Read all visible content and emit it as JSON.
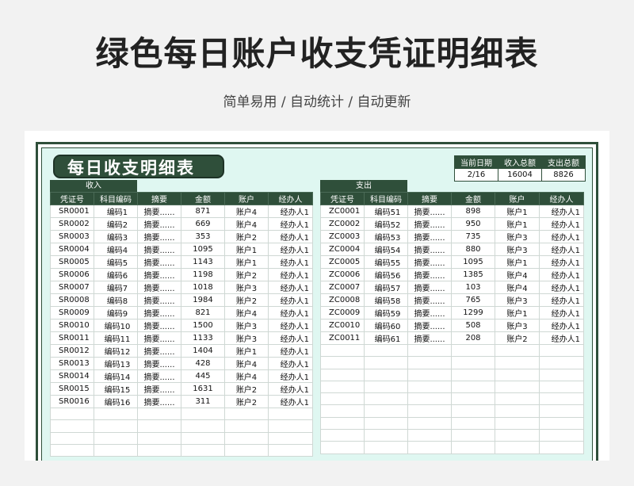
{
  "title": "绿色每日账户收支凭证明细表",
  "subtitle": "简单易用 / 自动统计 / 自动更新",
  "sheet_title": "每日收支明细表",
  "summary": {
    "headers": [
      "当前日期",
      "收入总额",
      "支出总额"
    ],
    "values": [
      "2/16",
      "16004",
      "8826"
    ]
  },
  "income": {
    "label": "收入",
    "headers": [
      "凭证号",
      "科目编码",
      "摘要",
      "金额",
      "账户",
      "经办人"
    ],
    "rows": [
      [
        "SR0001",
        "编码1",
        "摘要......",
        "871",
        "账户4",
        "经办人1"
      ],
      [
        "SR0002",
        "编码2",
        "摘要......",
        "669",
        "账户4",
        "经办人1"
      ],
      [
        "SR0003",
        "编码3",
        "摘要......",
        "353",
        "账户2",
        "经办人1"
      ],
      [
        "SR0004",
        "编码4",
        "摘要......",
        "1095",
        "账户1",
        "经办人1"
      ],
      [
        "SR0005",
        "编码5",
        "摘要......",
        "1143",
        "账户1",
        "经办人1"
      ],
      [
        "SR0006",
        "编码6",
        "摘要......",
        "1198",
        "账户2",
        "经办人1"
      ],
      [
        "SR0007",
        "编码7",
        "摘要......",
        "1018",
        "账户3",
        "经办人1"
      ],
      [
        "SR0008",
        "编码8",
        "摘要......",
        "1984",
        "账户2",
        "经办人1"
      ],
      [
        "SR0009",
        "编码9",
        "摘要......",
        "821",
        "账户4",
        "经办人1"
      ],
      [
        "SR0010",
        "编码10",
        "摘要......",
        "1500",
        "账户3",
        "经办人1"
      ],
      [
        "SR0011",
        "编码11",
        "摘要......",
        "1133",
        "账户3",
        "经办人1"
      ],
      [
        "SR0012",
        "编码12",
        "摘要......",
        "1404",
        "账户1",
        "经办人1"
      ],
      [
        "SR0013",
        "编码13",
        "摘要......",
        "428",
        "账户4",
        "经办人1"
      ],
      [
        "SR0014",
        "编码14",
        "摘要......",
        "445",
        "账户4",
        "经办人1"
      ],
      [
        "SR0015",
        "编码15",
        "摘要......",
        "1631",
        "账户2",
        "经办人1"
      ],
      [
        "SR0016",
        "编码16",
        "摘要......",
        "311",
        "账户2",
        "经办人1"
      ]
    ]
  },
  "expense": {
    "label": "支出",
    "headers": [
      "凭证号",
      "科目编码",
      "摘要",
      "金额",
      "账户",
      "经办人"
    ],
    "rows": [
      [
        "ZC0001",
        "编码51",
        "摘要......",
        "898",
        "账户1",
        "经办人1"
      ],
      [
        "ZC0002",
        "编码52",
        "摘要......",
        "950",
        "账户1",
        "经办人1"
      ],
      [
        "ZC0003",
        "编码53",
        "摘要......",
        "735",
        "账户3",
        "经办人1"
      ],
      [
        "ZC0004",
        "编码54",
        "摘要......",
        "880",
        "账户3",
        "经办人1"
      ],
      [
        "ZC0005",
        "编码55",
        "摘要......",
        "1095",
        "账户1",
        "经办人1"
      ],
      [
        "ZC0006",
        "编码56",
        "摘要......",
        "1385",
        "账户4",
        "经办人1"
      ],
      [
        "ZC0007",
        "编码57",
        "摘要......",
        "103",
        "账户4",
        "经办人1"
      ],
      [
        "ZC0008",
        "编码58",
        "摘要......",
        "765",
        "账户3",
        "经办人1"
      ],
      [
        "ZC0009",
        "编码59",
        "摘要......",
        "1299",
        "账户1",
        "经办人1"
      ],
      [
        "ZC0010",
        "编码60",
        "摘要......",
        "508",
        "账户3",
        "经办人1"
      ],
      [
        "ZC0011",
        "编码61",
        "摘要......",
        "208",
        "账户2",
        "经办人1"
      ]
    ]
  }
}
